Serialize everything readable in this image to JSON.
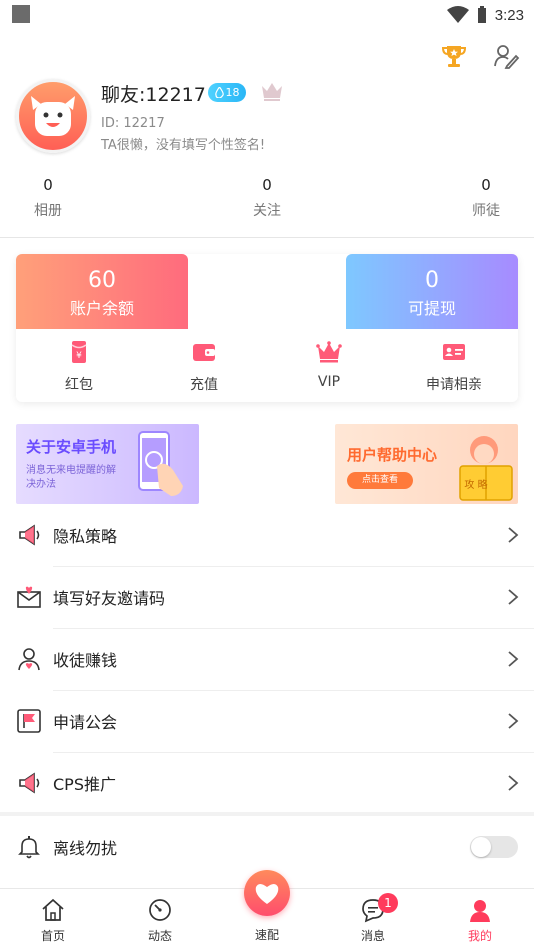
{
  "status_bar": {
    "time": "3:23"
  },
  "profile": {
    "nickname": "聊友:12217",
    "level": "18",
    "id_text": "ID: 12217",
    "signature": "TA很懒，没有填写个性签名!"
  },
  "stats": [
    {
      "value": "0",
      "label": "相册"
    },
    {
      "value": "0",
      "label": "关注"
    },
    {
      "value": "0",
      "label": "师徒"
    }
  ],
  "wallet": {
    "balance_value": "60",
    "balance_label": "账户余额",
    "withdraw_value": "0",
    "withdraw_label": "可提现",
    "actions": [
      {
        "label": "红包",
        "icon": "red-envelope-icon"
      },
      {
        "label": "充值",
        "icon": "wallet-icon"
      },
      {
        "label": "VIP",
        "icon": "crown-icon"
      },
      {
        "label": "申请相亲",
        "icon": "id-card-icon"
      }
    ]
  },
  "banners": {
    "left_title": "关于安卓手机",
    "left_sub": "消息无来电提醒的解决办法",
    "right_title": "用户帮助中心",
    "right_button": "点击查看",
    "right_book": "攻 略"
  },
  "menu": [
    {
      "label": "隐私策略",
      "icon": "megaphone-icon"
    },
    {
      "label": "填写好友邀请码",
      "icon": "envelope-heart-icon"
    },
    {
      "label": "收徒赚钱",
      "icon": "user-heart-icon"
    },
    {
      "label": "申请公会",
      "icon": "flag-icon"
    },
    {
      "label": "CPS推广",
      "icon": "megaphone-icon"
    }
  ],
  "settings": {
    "dnd_label": "离线勿扰",
    "dnd_on": false
  },
  "tabbar": {
    "items": [
      {
        "label": "首页",
        "icon": "home-icon"
      },
      {
        "label": "动态",
        "icon": "gauge-icon"
      },
      {
        "label": "速配",
        "icon": "heart-icon"
      },
      {
        "label": "消息",
        "icon": "chat-icon"
      },
      {
        "label": "我的",
        "icon": "user-icon"
      }
    ],
    "message_badge": "1",
    "active": "我的"
  },
  "colors": {
    "accent": "#ff3b5c",
    "balance_gradient": [
      "#ffa07a",
      "#ff6b7d"
    ],
    "withdraw_gradient": [
      "#7ec8ff",
      "#a78bff"
    ]
  }
}
